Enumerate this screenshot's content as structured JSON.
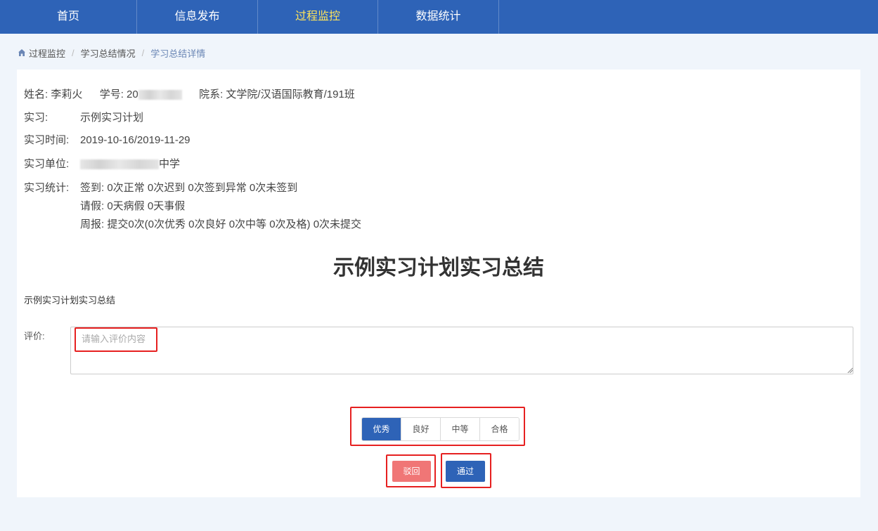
{
  "nav": {
    "items": [
      {
        "label": "首页"
      },
      {
        "label": "信息发布"
      },
      {
        "label": "过程监控"
      },
      {
        "label": "数据统计"
      }
    ],
    "active": "过程监控"
  },
  "breadcrumb": {
    "home_icon": "home-icon",
    "items": [
      "过程监控",
      "学习总结情况",
      "学习总结详情"
    ],
    "separator": "/"
  },
  "student": {
    "name_label": "姓名:",
    "name": "李莉火",
    "id_label": "学号:",
    "id_prefix": "20",
    "dept_label": "院系:",
    "dept": "文学院/汉语国际教育/191班"
  },
  "internship": {
    "plan_label": "实习:",
    "plan": "示例实习计划",
    "time_label": "实习时间:",
    "time": "2019-10-16/2019-11-29",
    "unit_label": "实习单位:",
    "unit_prefix": "",
    "unit_suffix": "中学",
    "stats_label": "实习统计:",
    "stats_signin": "签到: 0次正常 0次迟到 0次签到异常 0次未签到",
    "stats_leave": "请假: 0天病假 0天事假",
    "stats_weekly": "周报: 提交0次(0次优秀 0次良好 0次中等 0次及格) 0次未提交"
  },
  "summary": {
    "title": "示例实习计划实习总结",
    "content": "示例实习计划实习总结"
  },
  "evaluation": {
    "label": "评价:",
    "placeholder": "请输入评价内容",
    "value": ""
  },
  "grades": {
    "options": [
      "优秀",
      "良好",
      "中等",
      "合格"
    ],
    "selected": "优秀"
  },
  "actions": {
    "reject_label": "驳回",
    "pass_label": "通过"
  },
  "colors": {
    "nav_bg": "#2e63b7",
    "nav_active": "#ffe45a",
    "primary": "#2e63b7",
    "reject": "#f07676",
    "highlight": "#e62020",
    "page_bg": "#f0f5fb"
  }
}
